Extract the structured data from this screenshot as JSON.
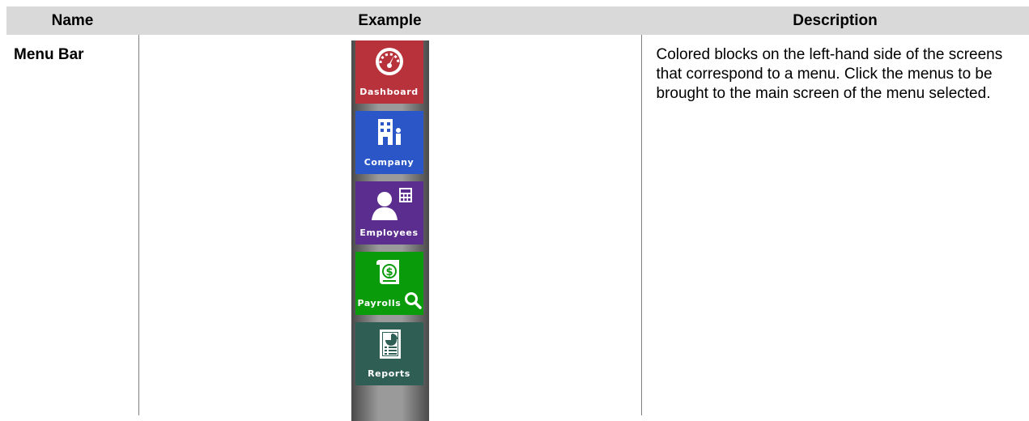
{
  "table": {
    "headers": {
      "name": "Name",
      "example": "Example",
      "description": "Description"
    },
    "row": {
      "name": "Menu Bar",
      "description": "Colored blocks on the left-hand side of the screens that correspond to a menu. Click the menus to be brought to the main screen of the menu selected."
    }
  },
  "menu_bar": {
    "items": [
      {
        "label": "Dashboard",
        "color": "#b8323c",
        "icon": "gauge-icon"
      },
      {
        "label": "Company",
        "color": "#2a56c8",
        "icon": "building-icon"
      },
      {
        "label": "Employees",
        "color": "#5b2d8e",
        "icon": "person-calculator-icon"
      },
      {
        "label": "Payrolls",
        "color": "#0a9b0a",
        "icon": "payroll-search-icon"
      },
      {
        "label": "Reports",
        "color": "#2f5e55",
        "icon": "report-icon"
      }
    ]
  }
}
